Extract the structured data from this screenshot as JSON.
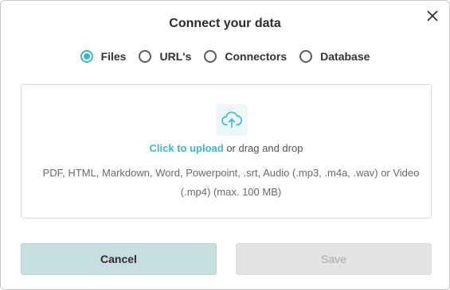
{
  "dialog": {
    "title": "Connect your data",
    "close_icon": "close-icon"
  },
  "source_options": {
    "selected": "Files",
    "items": [
      {
        "label": "Files",
        "selected": true
      },
      {
        "label": "URL's",
        "selected": false
      },
      {
        "label": "Connectors",
        "selected": false
      },
      {
        "label": "Database",
        "selected": false
      }
    ]
  },
  "dropzone": {
    "icon": "cloud-upload-icon",
    "link_text": "Click to upload",
    "suffix_text": " or drag and drop",
    "formats_text": "PDF, HTML, Markdown, Word, Powerpoint, .srt, Audio (.mp3, .m4a, .wav) or Video (.mp4) (max. 100 MB)"
  },
  "actions": {
    "cancel_label": "Cancel",
    "save_label": "Save"
  },
  "colors": {
    "accent": "#3bb8c3",
    "cancel_bg": "#c6dedf",
    "save_disabled_bg": "#e4e4e4"
  }
}
